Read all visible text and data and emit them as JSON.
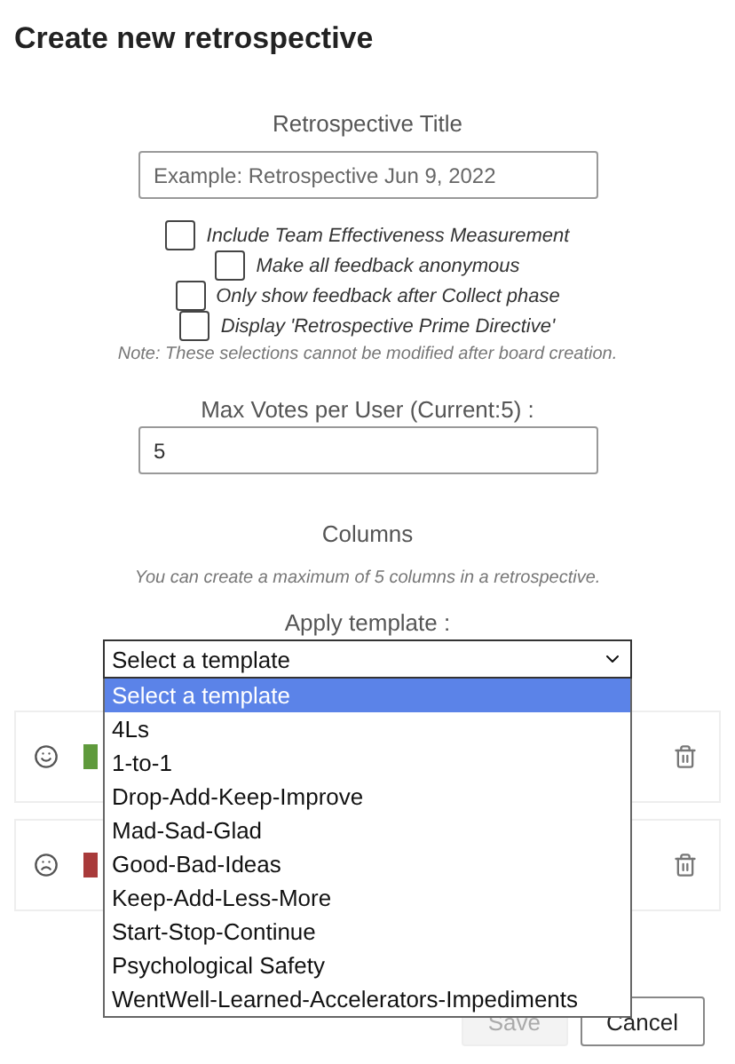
{
  "dialog": {
    "title": "Create new retrospective"
  },
  "title_field": {
    "label": "Retrospective Title",
    "placeholder": "Example: Retrospective Jun 9, 2022"
  },
  "options": [
    {
      "label": "Include Team Effectiveness Measurement",
      "checked": false
    },
    {
      "label": "Make all feedback anonymous",
      "checked": false
    },
    {
      "label": "Only show feedback after Collect phase",
      "checked": false
    },
    {
      "label": "Display 'Retrospective Prime Directive'",
      "checked": false
    }
  ],
  "options_note": "Note: These selections cannot be modified after board creation.",
  "votes_field": {
    "label": "Max Votes per User (Current:5) :",
    "value": "5"
  },
  "columns_section": {
    "heading": "Columns",
    "note": "You can create a maximum of 5 columns in a retrospective."
  },
  "template": {
    "label": "Apply template :",
    "value": "Select a template",
    "expanded": true,
    "options": [
      {
        "label": "Select a template",
        "selected": true
      },
      {
        "label": "4Ls",
        "selected": false
      },
      {
        "label": "1-to-1",
        "selected": false
      },
      {
        "label": "Drop-Add-Keep-Improve",
        "selected": false
      },
      {
        "label": "Mad-Sad-Glad",
        "selected": false
      },
      {
        "label": "Good-Bad-Ideas",
        "selected": false
      },
      {
        "label": "Keep-Add-Less-More",
        "selected": false
      },
      {
        "label": "Start-Stop-Continue",
        "selected": false
      },
      {
        "label": "Psychological Safety",
        "selected": false
      },
      {
        "label": "WentWell-Learned-Accelerators-Impediments",
        "selected": false
      }
    ]
  },
  "columns": [
    {
      "kind": "happy",
      "color": "#5f9a3c"
    },
    {
      "kind": "sad",
      "color": "#a83a3a"
    }
  ],
  "buttons": [
    {
      "label": "Save",
      "disabled": true
    },
    {
      "label": "Cancel",
      "disabled": false
    }
  ]
}
